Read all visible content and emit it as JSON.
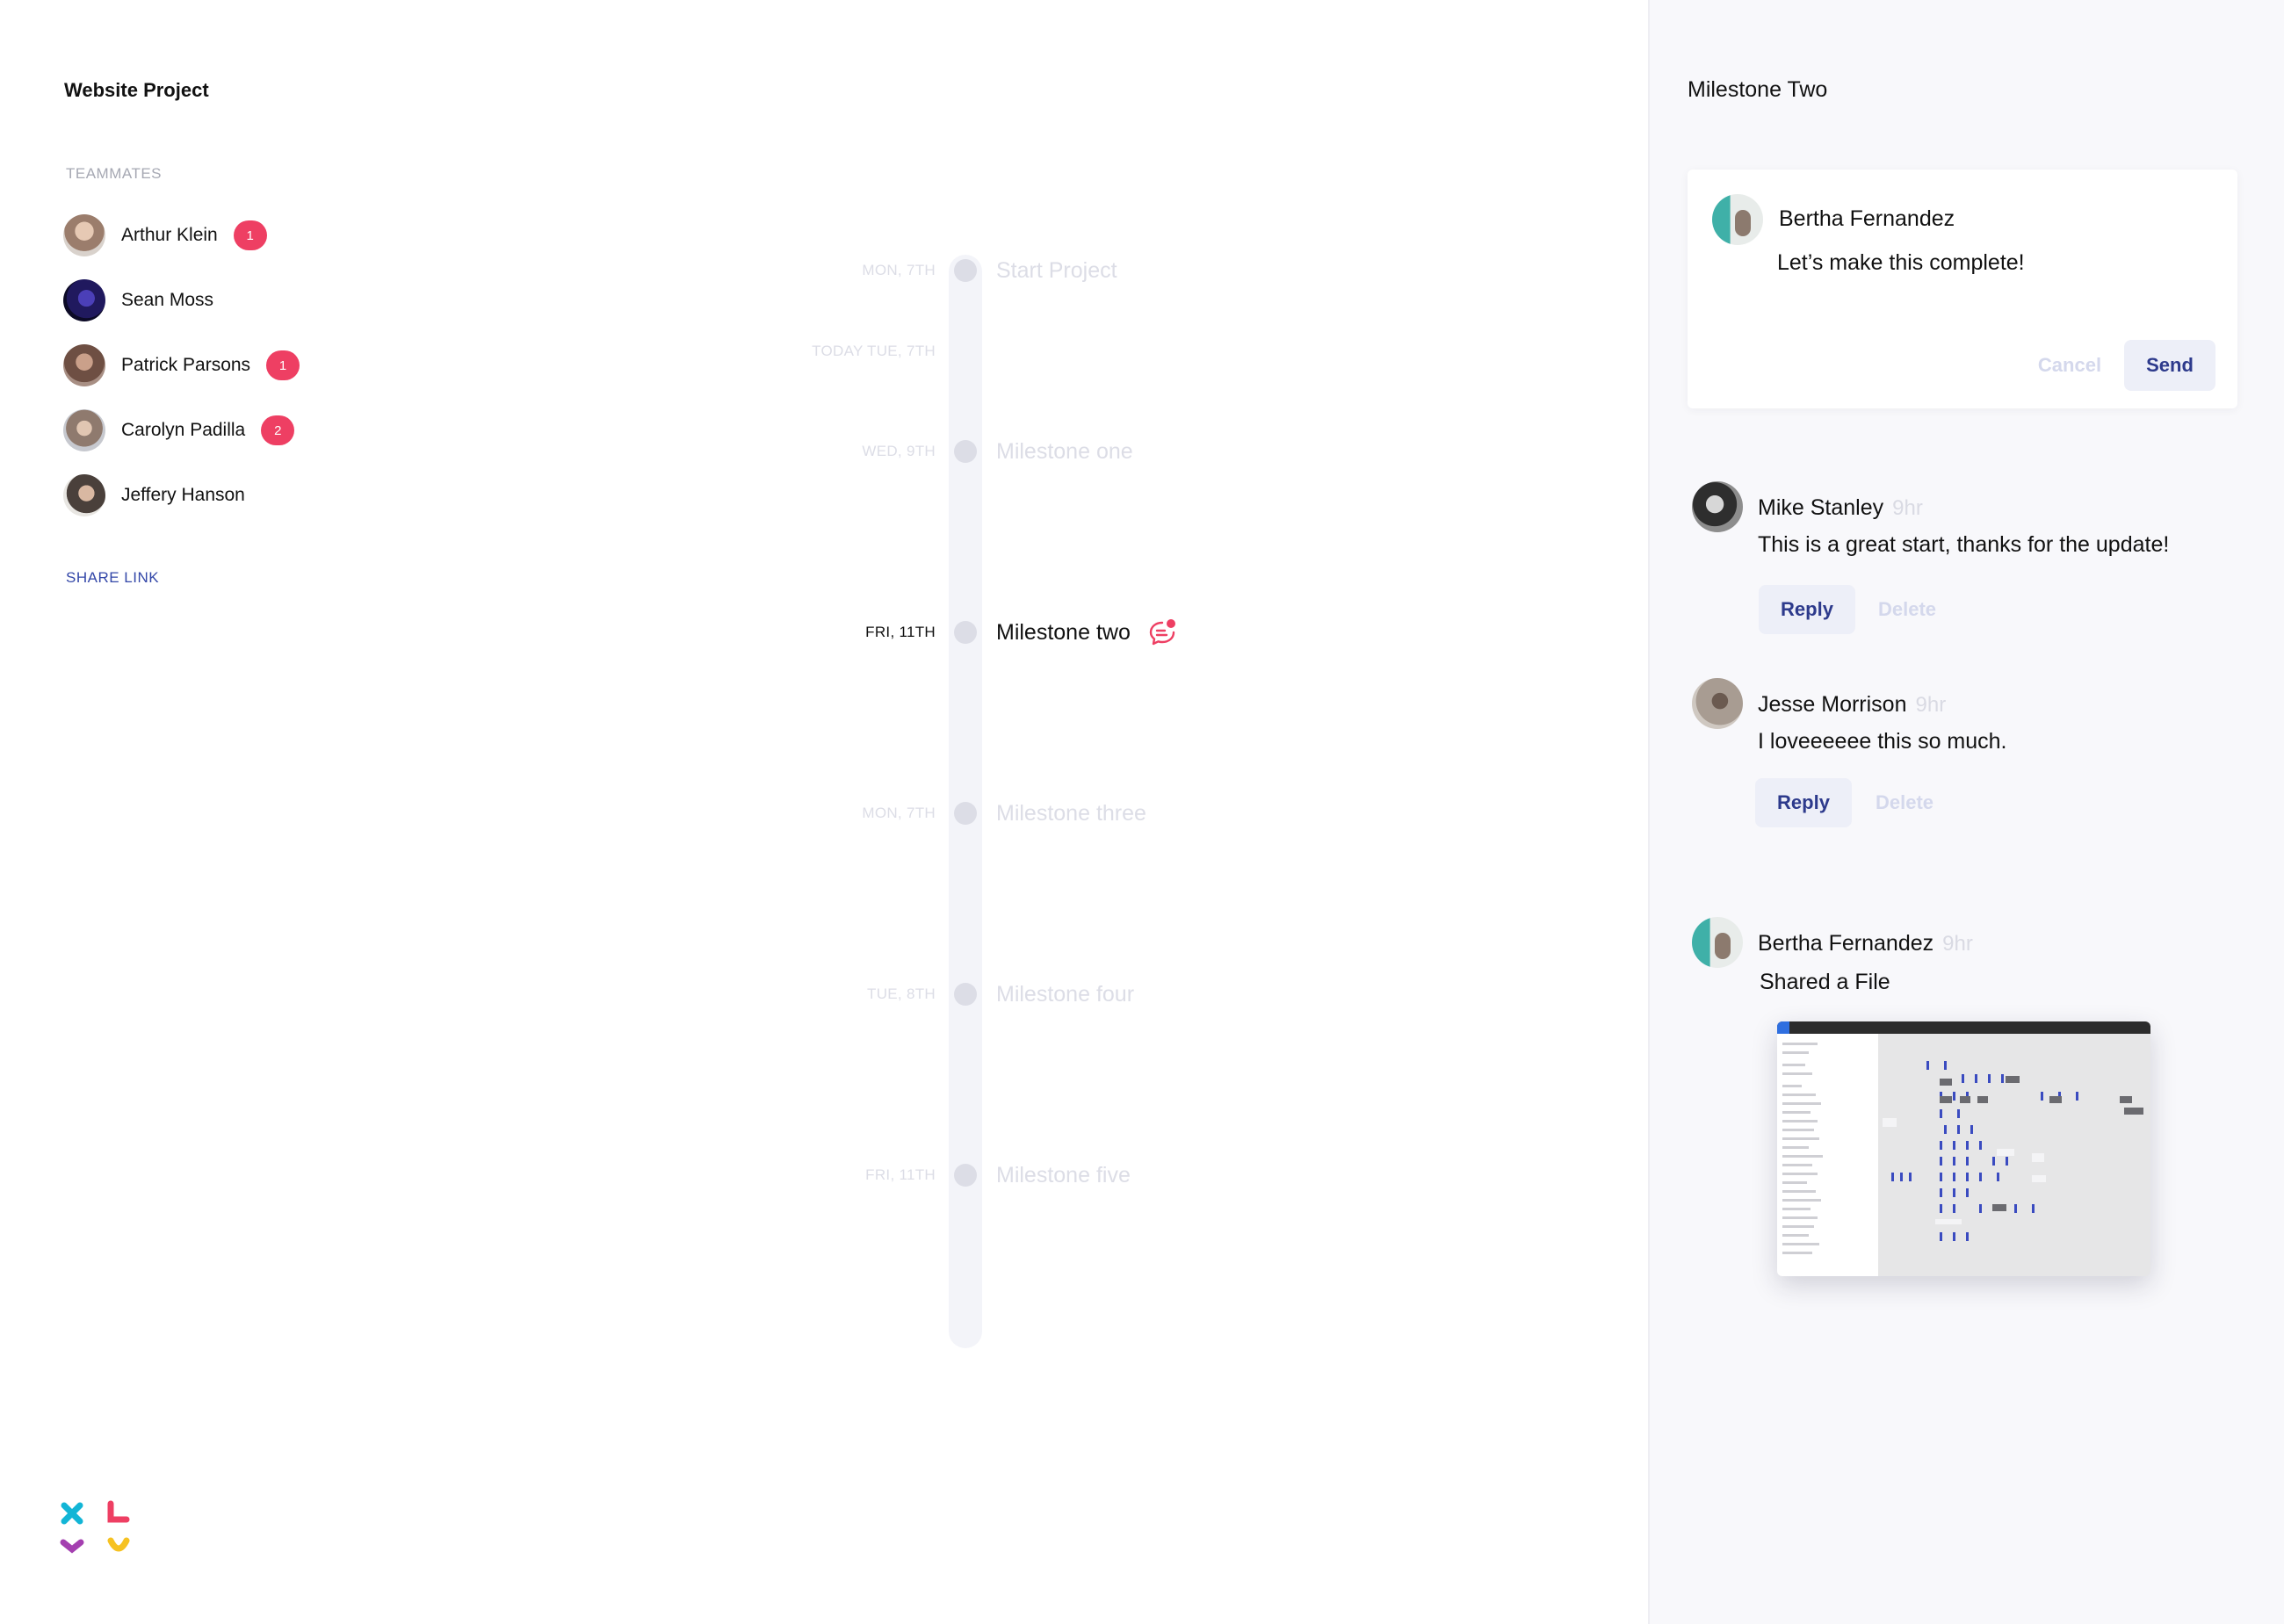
{
  "project": {
    "title": "Website Project"
  },
  "teammates": {
    "label": "TEAMMATES",
    "items": [
      {
        "name": "Arthur Klein",
        "badge": "1"
      },
      {
        "name": "Sean Moss",
        "badge": ""
      },
      {
        "name": "Patrick Parsons",
        "badge": "1"
      },
      {
        "name": "Carolyn Padilla",
        "badge": "2"
      },
      {
        "name": "Jeffery Hanson",
        "badge": ""
      }
    ],
    "share_link": "SHARE LINK"
  },
  "timeline": {
    "today_label": "TODAY TUE, 7TH",
    "milestones": [
      {
        "date": "MON, 7TH",
        "title": "Start Project"
      },
      {
        "date": "WED, 9TH",
        "title": "Milestone one"
      },
      {
        "date": "FRI, 11TH",
        "title": "Milestone two",
        "active": true
      },
      {
        "date": "MON, 7TH",
        "title": "Milestone three"
      },
      {
        "date": "TUE, 8TH",
        "title": "Milestone four"
      },
      {
        "date": "FRI, 11TH",
        "title": "Milestone five"
      }
    ]
  },
  "panel": {
    "title": "Milestone Two",
    "compose": {
      "author": "Bertha Fernandez",
      "text": "Let’s make this complete!",
      "cancel_label": "Cancel",
      "send_label": "Send"
    },
    "comments": [
      {
        "author": "Mike Stanley",
        "time": "9hr",
        "text": "This is a great start, thanks for the update!",
        "reply_label": "Reply",
        "delete_label": "Delete"
      },
      {
        "author": "Jesse Morrison",
        "time": "9hr",
        "text": "I loveeeeee this so much.",
        "reply_label": "Reply",
        "delete_label": "Delete"
      },
      {
        "author": "Bertha Fernandez",
        "time": "9hr",
        "text": "Shared a File"
      }
    ]
  },
  "colors": {
    "badge": "#ee3f63",
    "accent": "#2d3a8c",
    "link": "#3347a8",
    "muted": "#dcdde6",
    "panel_bg": "#f8f8fb"
  }
}
